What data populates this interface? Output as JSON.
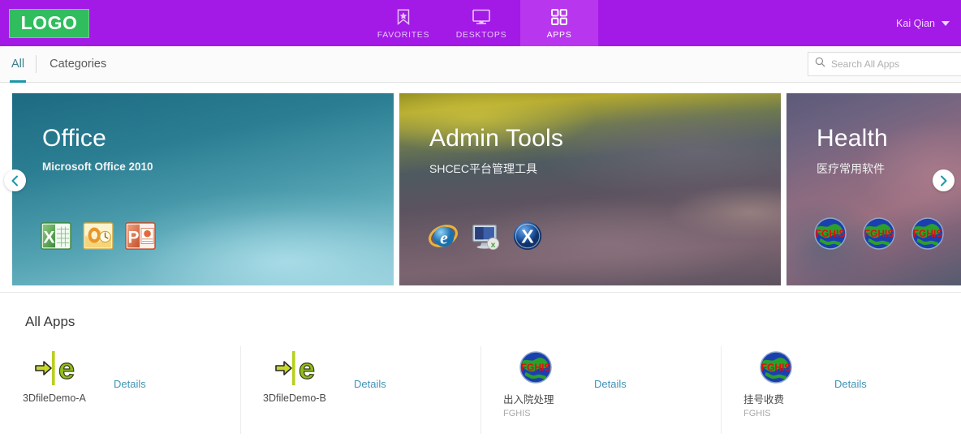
{
  "brand": {
    "logo_text": "LOGO",
    "purple": "#a319e6",
    "green": "#2fbd5e",
    "teal": "#1a97aa"
  },
  "topbar": {
    "tabs": [
      {
        "label": "FAVORITES",
        "icon": "bookmark-icon",
        "active": false
      },
      {
        "label": "DESKTOPS",
        "icon": "monitor-icon",
        "active": false
      },
      {
        "label": "APPS",
        "icon": "grid-icon",
        "active": true
      }
    ],
    "user": {
      "name": "Kai Qian",
      "caret": "chevron-down-icon"
    }
  },
  "subnav": {
    "tabs": [
      {
        "label": "All",
        "active": true
      },
      {
        "label": "Categories",
        "active": false
      }
    ],
    "search": {
      "placeholder": "Search All Apps",
      "value": "",
      "icon": "search-icon"
    }
  },
  "carousel": {
    "prev_label": "chevron-left-icon",
    "next_label": "chevron-right-icon",
    "cards": [
      {
        "title": "Office",
        "subtitle": "Microsoft Office 2010",
        "icons": [
          "excel-icon",
          "outlook-icon",
          "powerpoint-icon"
        ]
      },
      {
        "title": "Admin Tools",
        "subtitle": "SHCEC平台管理工具",
        "icons": [
          "internet-explorer-icon",
          "remote-desktop-icon",
          "x-app-icon"
        ]
      },
      {
        "title": "Health",
        "subtitle": "医疗常用软件",
        "icons": [
          "fghis-icon",
          "fghis-icon",
          "fghis-icon"
        ]
      }
    ]
  },
  "all_apps": {
    "heading": "All Apps",
    "details_label": "Details",
    "items": [
      {
        "name": "3DfileDemo-A",
        "sub": "",
        "icon": "e-demo-icon",
        "details": "Details"
      },
      {
        "name": "3DfileDemo-B",
        "sub": "",
        "icon": "e-demo-icon",
        "details": "Details"
      },
      {
        "name": "出入院处理",
        "sub": "FGHIS",
        "icon": "fghis-icon",
        "details": "Details"
      },
      {
        "name": "挂号收费",
        "sub": "FGHIS",
        "icon": "fghis-icon",
        "details": "Details"
      }
    ]
  }
}
